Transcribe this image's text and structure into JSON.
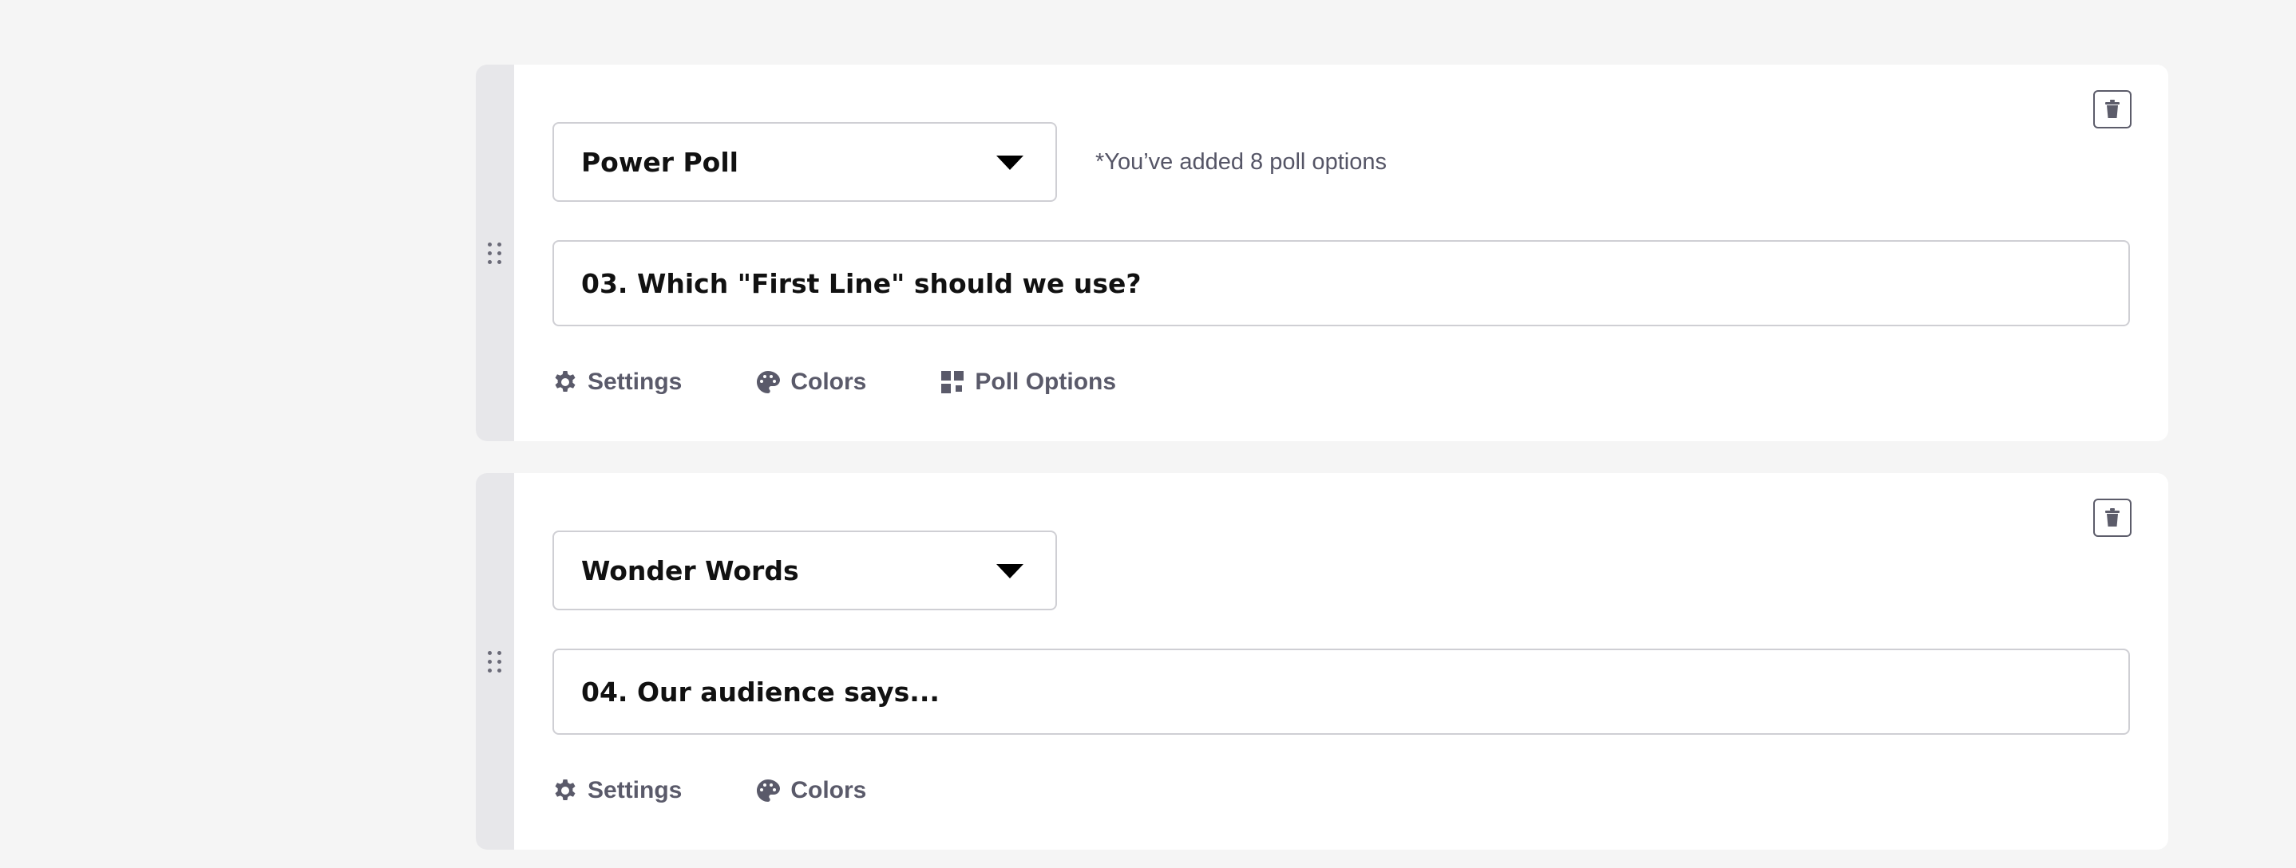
{
  "cards": [
    {
      "type_label": "Power Poll",
      "hint": "*You’ve added 8 poll options",
      "question": "03. Which \"First Line\" should we use?",
      "tabs": [
        {
          "label": "Settings",
          "icon": "gear-icon"
        },
        {
          "label": "Colors",
          "icon": "palette-icon"
        },
        {
          "label": "Poll Options",
          "icon": "grid-icon"
        }
      ]
    },
    {
      "type_label": "Wonder Words",
      "question": "04. Our audience says...",
      "tabs": [
        {
          "label": "Settings",
          "icon": "gear-icon"
        },
        {
          "label": "Colors",
          "icon": "palette-icon"
        }
      ]
    }
  ],
  "colors": {
    "background": "#f5f5f5",
    "card": "#ffffff",
    "drag_strip": "#e7e7ea",
    "tab_text": "#5a5a6a",
    "border": "#cfcfd4"
  }
}
